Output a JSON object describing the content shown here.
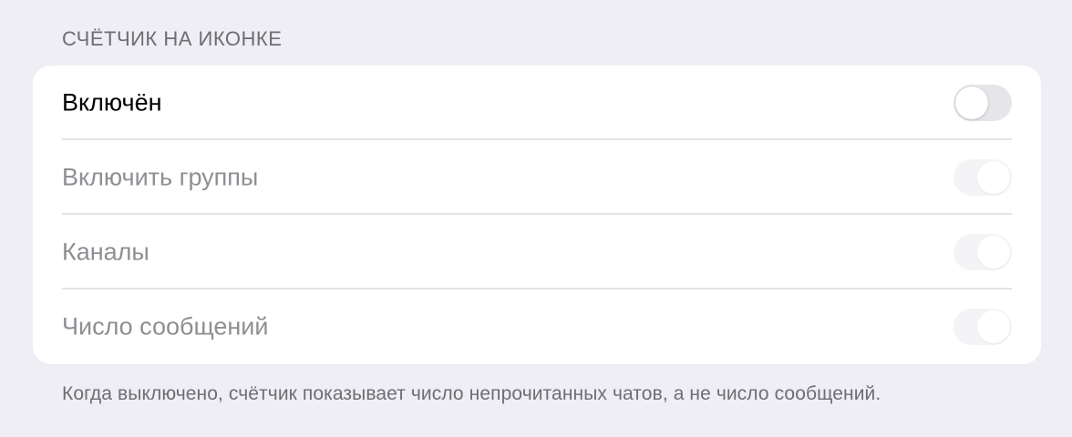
{
  "section": {
    "header": "СЧЁТЧИК НА ИКОНКЕ",
    "footer": "Когда выключено, счётчик показывает число непрочитанных чатов, а не число сообщений."
  },
  "rows": [
    {
      "label": "Включён",
      "toggle_on": false,
      "enabled": true
    },
    {
      "label": "Включить группы",
      "toggle_on": true,
      "enabled": false
    },
    {
      "label": "Каналы",
      "toggle_on": true,
      "enabled": false
    },
    {
      "label": "Число сообщений",
      "toggle_on": true,
      "enabled": false
    }
  ],
  "colors": {
    "background": "#efeef4",
    "card": "#ffffff",
    "secondary_text": "#6d6d72",
    "disabled_text": "#8e8e93"
  }
}
